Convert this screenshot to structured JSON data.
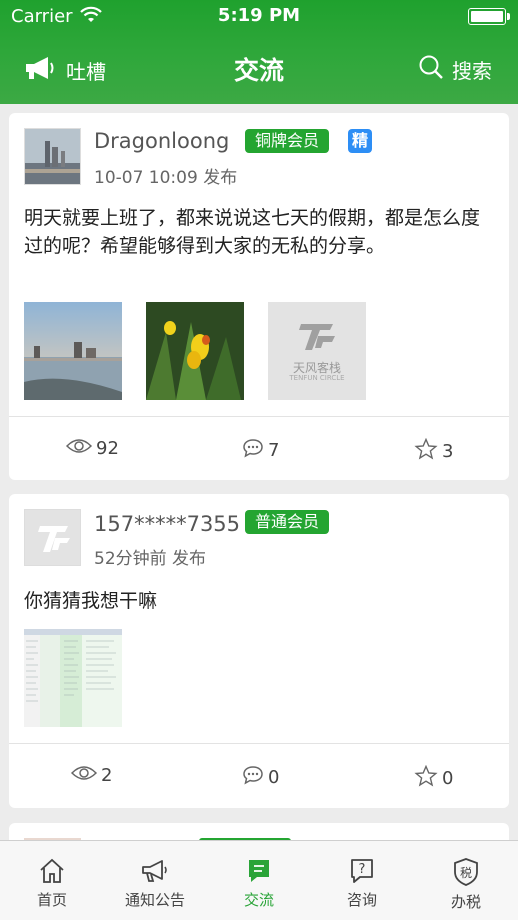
{
  "status_bar": {
    "carrier": "Carrier",
    "time": "5:19 PM"
  },
  "nav": {
    "left_label": "吐槽",
    "title": "交流",
    "right_label": "搜索"
  },
  "posts": [
    {
      "username": "Dragonloong",
      "badge": "铜牌会员",
      "featured": "精",
      "time": "10-07 10:09 发布",
      "content": "明天就要上班了，都来说说这七天的假期，都是怎么度过的呢？希望能够得到大家的无私的分享。",
      "placeholder_logo_title": "天风客栈",
      "placeholder_logo_sub": "TENFUN CIRCLE",
      "views": "92",
      "comments": "7",
      "favorites": "3"
    },
    {
      "username": "157*****7355",
      "badge": "普通会员",
      "time": "52分钟前 发布",
      "content": "你猜猜我想干嘛",
      "views": "2",
      "comments": "0",
      "favorites": "0"
    }
  ],
  "tabs": [
    {
      "label": "首页",
      "icon": "home-icon"
    },
    {
      "label": "通知公告",
      "icon": "megaphone-icon"
    },
    {
      "label": "交流",
      "icon": "chat-icon"
    },
    {
      "label": "咨询",
      "icon": "question-icon"
    },
    {
      "label": "办税",
      "icon": "tax-shield-icon"
    }
  ],
  "colors": {
    "brand_green": "#2aa438",
    "badge_green": "#24a531",
    "featured_blue": "#2d8ef5"
  }
}
